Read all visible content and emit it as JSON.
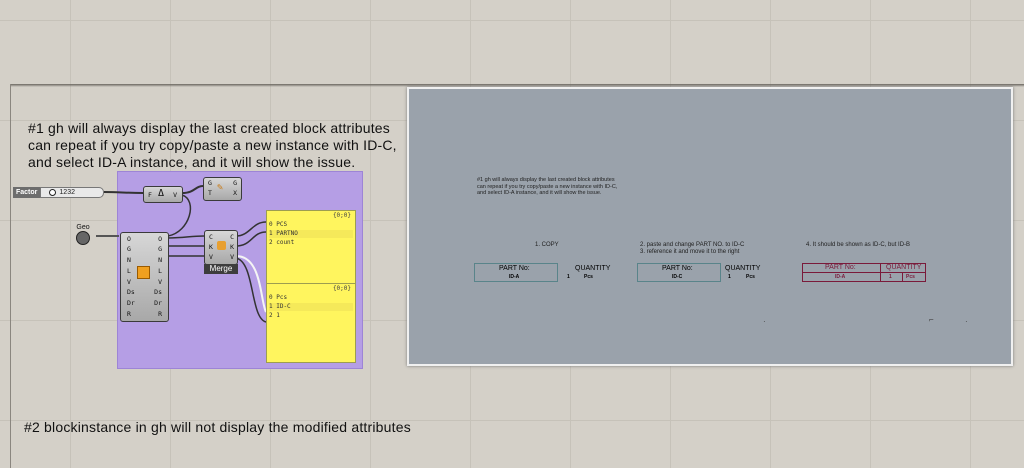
{
  "notes": {
    "note1_lines": [
      "#1 gh will always display the last created block attributes",
      "can repeat if you try copy/paste a new instance with ID-C,",
      "and select ID-A instance, and it will show the issue."
    ],
    "note2": "#2 blockinstance in gh will not display the modified attributes"
  },
  "slider": {
    "label": "Factor",
    "value": "1232"
  },
  "geo_label": "Geo",
  "expr_component": {
    "left": "F",
    "right": "V"
  },
  "func_component": {
    "in1": "G",
    "in2": "T",
    "out1": "G",
    "out2": "X"
  },
  "block_component": {
    "inputs": [
      "O",
      "G",
      "N",
      "L",
      "V",
      "Ds",
      "Dr",
      "R"
    ],
    "outputs": [
      "O",
      "G",
      "N",
      "L",
      "V",
      "Ds",
      "Dr",
      "R"
    ]
  },
  "merge_component": {
    "in1": "C",
    "in2": "K",
    "in3": "V",
    "out1": "C",
    "out2": "K",
    "out3": "V",
    "label": "Merge"
  },
  "panel_top": {
    "header": "{0;0}",
    "rows": [
      "0 PCS",
      "1 PARTNO",
      "2 count"
    ]
  },
  "panel_bottom": {
    "header": "{0;0}",
    "rows": [
      "0 Pcs",
      "1 ID-C",
      "2 1"
    ]
  },
  "viewport": {
    "note_lines": [
      "#1 gh will always display the last created block attributes",
      "can repeat if you try copy/paste a new instance with ID-C,",
      "and select ID-A instance, and it will show the issue."
    ],
    "step1": "1. COPY",
    "step2_lines": [
      "2. paste and change PART NO. to ID-C",
      "3. reference it and move it to the right"
    ],
    "step4": "4. It should be shown as ID-C, but ID-B",
    "table1": {
      "part_label": "PART No:",
      "qty_label": "QUANTITY",
      "id": "ID-A",
      "qty": "1",
      "unit": "Pcs"
    },
    "table2": {
      "part_label": "PART No:",
      "qty_label": "QUANTITY",
      "id": "ID-C",
      "qty": "1",
      "unit": "Pcs"
    },
    "table3": {
      "part_label": "PART No:",
      "qty_label": "QUANTITY",
      "id": "ID-A",
      "qty": "1",
      "unit": "Pcs"
    }
  }
}
